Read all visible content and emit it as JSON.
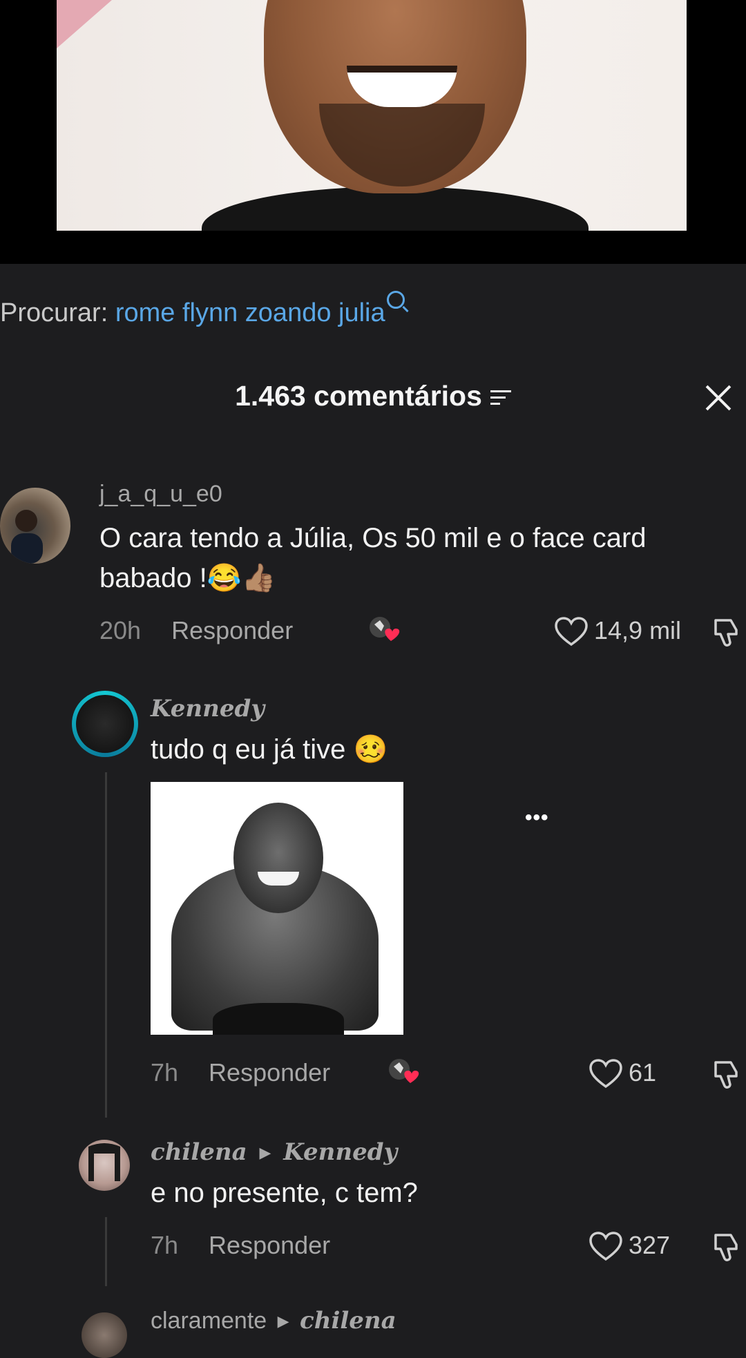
{
  "search": {
    "prefix": "Procurar:",
    "query": "rome flynn zoando julia"
  },
  "header": {
    "count_label": "1.463 comentários"
  },
  "comments": [
    {
      "username": "j_a_q_u_e0",
      "text": "O cara tendo a Júlia, Os 50 mil e o face card babado !😂👍🏽",
      "time": "20h",
      "reply_label": "Responder",
      "likes": "14,9 mil"
    },
    {
      "username": "Kennedy",
      "text": "tudo q eu já tive 🥴",
      "time": "7h",
      "reply_label": "Responder",
      "likes": "61"
    },
    {
      "username": "chilena",
      "reply_to": "Kennedy",
      "text": "e no presente, c tem?",
      "time": "7h",
      "reply_label": "Responder",
      "likes": "327"
    },
    {
      "username": "claramente",
      "reply_to": "chilena"
    }
  ],
  "more_label": "•••",
  "colors": {
    "background": "#1d1d1f",
    "query_blue": "#5aa7e6",
    "muted": "#a8a8a8"
  }
}
